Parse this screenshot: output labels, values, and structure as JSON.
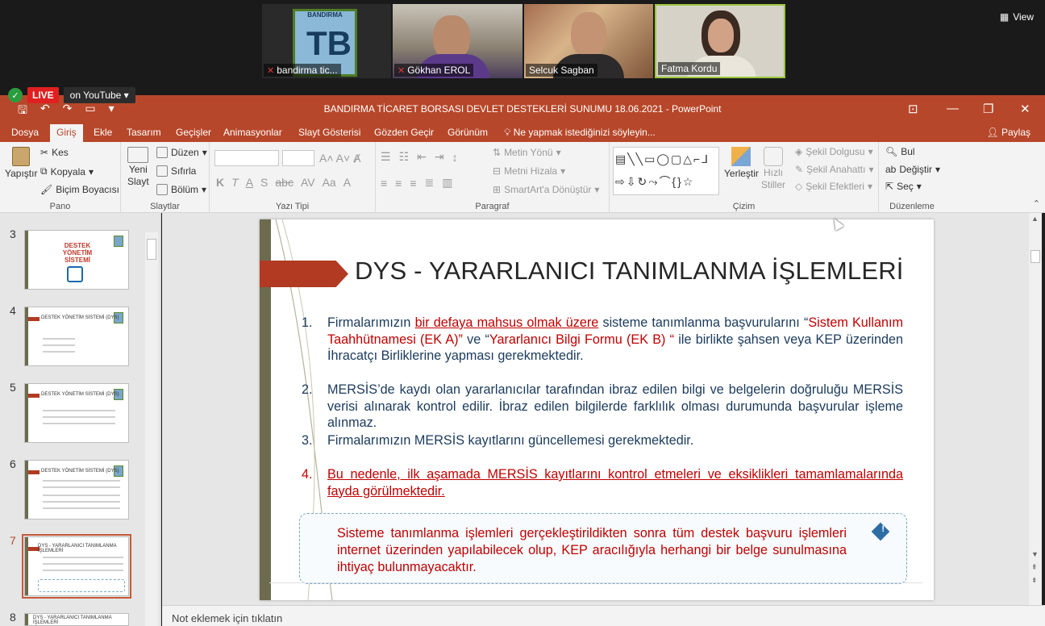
{
  "zoom": {
    "view_label": "View",
    "participants": [
      {
        "name": "bandirma tic...",
        "muted": true
      },
      {
        "name": "Gökhan EROL",
        "muted": true
      },
      {
        "name": "Selcuk Sagban",
        "muted": false
      },
      {
        "name": "Fatma Kordu",
        "muted": false
      }
    ],
    "logo_text": "BANDIRMA",
    "live_label": "LIVE",
    "youtube_label": "on YouTube"
  },
  "window": {
    "title": "BANDIRMA TİCARET BORSASI DEVLET DESTEKLERİ SUNUMU 18.06.2021 - PowerPoint"
  },
  "tabs": [
    "Dosya",
    "Giriş",
    "Ekle",
    "Tasarım",
    "Geçişler",
    "Animasyonlar",
    "Slayt Gösterisi",
    "Gözden Geçir",
    "Görünüm"
  ],
  "active_tab": "Giriş",
  "tell_me": "Ne yapmak istediğinizi söyleyin...",
  "share_label": "Paylaş",
  "ribbon": {
    "pano": {
      "label": "Pano",
      "paste": "Yapıştır",
      "cut": "Kes",
      "copy": "Kopyala",
      "format_painter": "Biçim Boyacısı"
    },
    "slaytlar": {
      "label": "Slaytlar",
      "new_slide_1": "Yeni",
      "new_slide_2": "Slayt",
      "layout": "Düzen",
      "reset": "Sıfırla",
      "section": "Bölüm"
    },
    "yazi_tipi": {
      "label": "Yazı Tipi"
    },
    "paragraf": {
      "label": "Paragraf",
      "text_direction": "Metin Yönü",
      "align_text": "Metni Hizala",
      "smartart": "SmartArt'a Dönüştür"
    },
    "cizim": {
      "label": "Çizim",
      "arrange": "Yerleştir",
      "quick_styles_1": "Hızlı",
      "quick_styles_2": "Stiller",
      "shape_fill": "Şekil Dolgusu",
      "shape_outline": "Şekil Anahattı",
      "shape_effects": "Şekil Efektleri"
    },
    "duzenleme": {
      "label": "Düzenleme",
      "find": "Bul",
      "replace": "Değiştir",
      "select": "Seç"
    }
  },
  "thumbnails": [
    {
      "num": "3",
      "title": "DESTEK YÖNETİM SİSTEMİ"
    },
    {
      "num": "4",
      "title": "DESTEK YÖNETİM SİSTEMİ (DYS)"
    },
    {
      "num": "5",
      "title": "DESTEK YÖNETİM SİSTEMİ (DYS)"
    },
    {
      "num": "6",
      "title": "DESTEK YÖNETİM SİSTEMİ (DYS)"
    },
    {
      "num": "7",
      "title": "DYS - YARARLANICI TANIMLANMA İŞLEMLERİ"
    },
    {
      "num": "8",
      "title": "DYS - YARARLANICI TANIMLANMA İŞLEMLERİ"
    }
  ],
  "active_thumbnail": "7",
  "slide": {
    "heading": "DYS - YARARLANICI TANIMLANMA İŞLEMLERİ",
    "items": [
      {
        "num": "1.",
        "parts": [
          {
            "text": "Firmalarımızın ",
            "style": "normal"
          },
          {
            "text": "bir defaya mahsus olmak üzere",
            "style": "red-ul"
          },
          {
            "text": " sisteme tanımlanma  başvurularını “",
            "style": "normal"
          },
          {
            "text": "Sistem Kullanım Taahhütnamesi (EK A)”",
            "style": "red"
          },
          {
            "text": " ve “",
            "style": "normal"
          },
          {
            "text": "Yararlanıcı  Bilgi Formu (EK B) “",
            "style": "red"
          },
          {
            "text": " ile birlikte şahsen veya KEP üzerinden İhracatçı  Birliklerine yapması gerekmektedir.",
            "style": "normal"
          }
        ]
      },
      {
        "num": "2.",
        "parts": [
          {
            "text": "MERSİS’de kaydı olan yararlanıcılar tarafından ibraz edilen bilgi ve  belgelerin doğruluğu MERSİS verisi alınarak kontrol edilir. İbraz edilen  bilgilerde farklılık olması durumunda başvurular işleme  alınmaz.",
            "style": "normal"
          }
        ]
      },
      {
        "num": "3.",
        "parts": [
          {
            "text": "Firmalarımızın MERSİS kayıtlarını güncellemesi gerekmektedir.",
            "style": "normal"
          }
        ]
      },
      {
        "num": "4.",
        "parts": [
          {
            "text": " Bu nedenle, ilk aşamada MERSİS kayıtlarını kontrol etmeleri ve eksiklikleri tamamlamalarında fayda görülmektedir.",
            "style": "red-ul"
          }
        ]
      }
    ],
    "callout": "Sisteme tanımlanma işlemleri gerçekleştirildikten sonra tüm destek başvuru işlemleri  internet üzerinden yapılabilecek olup, KEP aracılığıyla herhangi bir belge sunulmasına  ihtiyaç bulunmayacaktır."
  },
  "notes_placeholder": "Not eklemek için tıklatın"
}
